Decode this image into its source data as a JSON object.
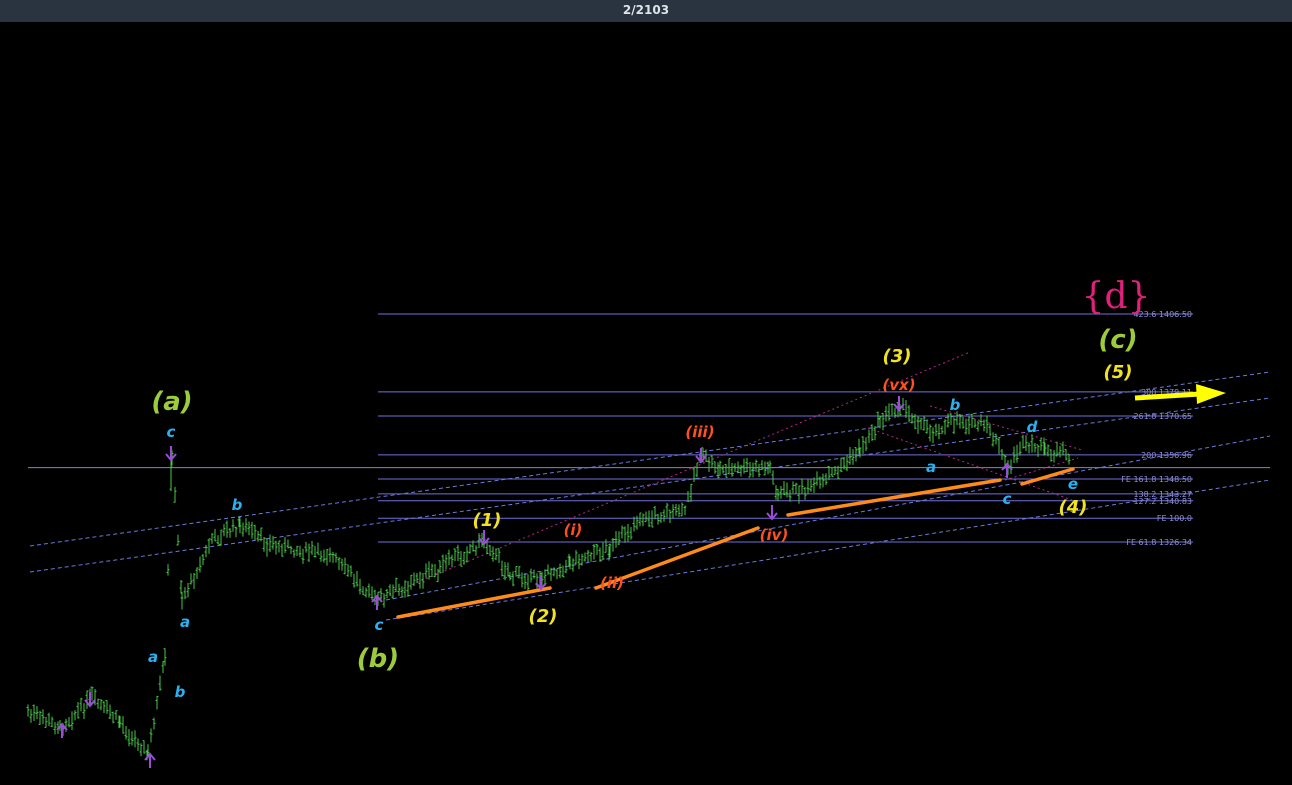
{
  "header": {
    "counter": "2/2103"
  },
  "chart_data": {
    "type": "candlestick",
    "title": "",
    "symbol_mark": "{d}",
    "colors": {
      "background": "#000000",
      "candles": "#46c846",
      "fib_lines": "#7070dc",
      "channel": "#6a78e0",
      "trendlines": "#ff8c1a",
      "arrow": "#ffff00",
      "wave_a_c": "#9ccc3c",
      "wave_1_5": "#f2e320",
      "wave_minor": "#ff5020",
      "wave_sub": "#2bb0f0",
      "pivot_arrows": "#9a4dd8",
      "d_mark": "#e0207a"
    },
    "fib_levels": [
      {
        "label": "423.6 1406.50",
        "price": 1406.5
      },
      {
        "label": "300 1379.11",
        "price": 1379.11
      },
      {
        "label": "261.8 1370.65",
        "price": 1370.65
      },
      {
        "label": "200 1356.96",
        "price": 1356.96
      },
      {
        "label": "FE 161.8 1348.50",
        "price": 1348.5
      },
      {
        "label": "138.2 1343.27",
        "price": 1343.27
      },
      {
        "label": "127.2 1340.83",
        "price": 1340.83
      },
      {
        "label": "FE 100.0",
        "price": 1334.7
      },
      {
        "label": "FE 61.8 1326.34",
        "price": 1326.34
      }
    ],
    "reference_line_price": 1352.5,
    "wave_labels": [
      {
        "text": "(a)",
        "group": "wave_a_c"
      },
      {
        "text": "(b)",
        "group": "wave_a_c"
      },
      {
        "text": "(c)",
        "group": "wave_a_c"
      },
      {
        "text": "(1)",
        "group": "wave_1_5"
      },
      {
        "text": "(2)",
        "group": "wave_1_5"
      },
      {
        "text": "(3)",
        "group": "wave_1_5"
      },
      {
        "text": "(4)",
        "group": "wave_1_5"
      },
      {
        "text": "(5)",
        "group": "wave_1_5"
      },
      {
        "text": "(i)",
        "group": "wave_minor"
      },
      {
        "text": "(ii)",
        "group": "wave_minor"
      },
      {
        "text": "(iii)",
        "group": "wave_minor"
      },
      {
        "text": "(iv)",
        "group": "wave_minor"
      },
      {
        "text": "(vx)",
        "group": "wave_minor"
      },
      {
        "text": "a",
        "group": "wave_sub"
      },
      {
        "text": "b",
        "group": "wave_sub"
      },
      {
        "text": "a",
        "group": "wave_sub"
      },
      {
        "text": "b",
        "group": "wave_sub"
      },
      {
        "text": "c",
        "group": "wave_sub"
      },
      {
        "text": "c",
        "group": "wave_sub"
      },
      {
        "text": "a",
        "group": "wave_sub"
      },
      {
        "text": "b",
        "group": "wave_sub"
      },
      {
        "text": "c",
        "group": "wave_sub"
      },
      {
        "text": "d",
        "group": "wave_sub"
      },
      {
        "text": "e",
        "group": "wave_sub"
      }
    ]
  }
}
